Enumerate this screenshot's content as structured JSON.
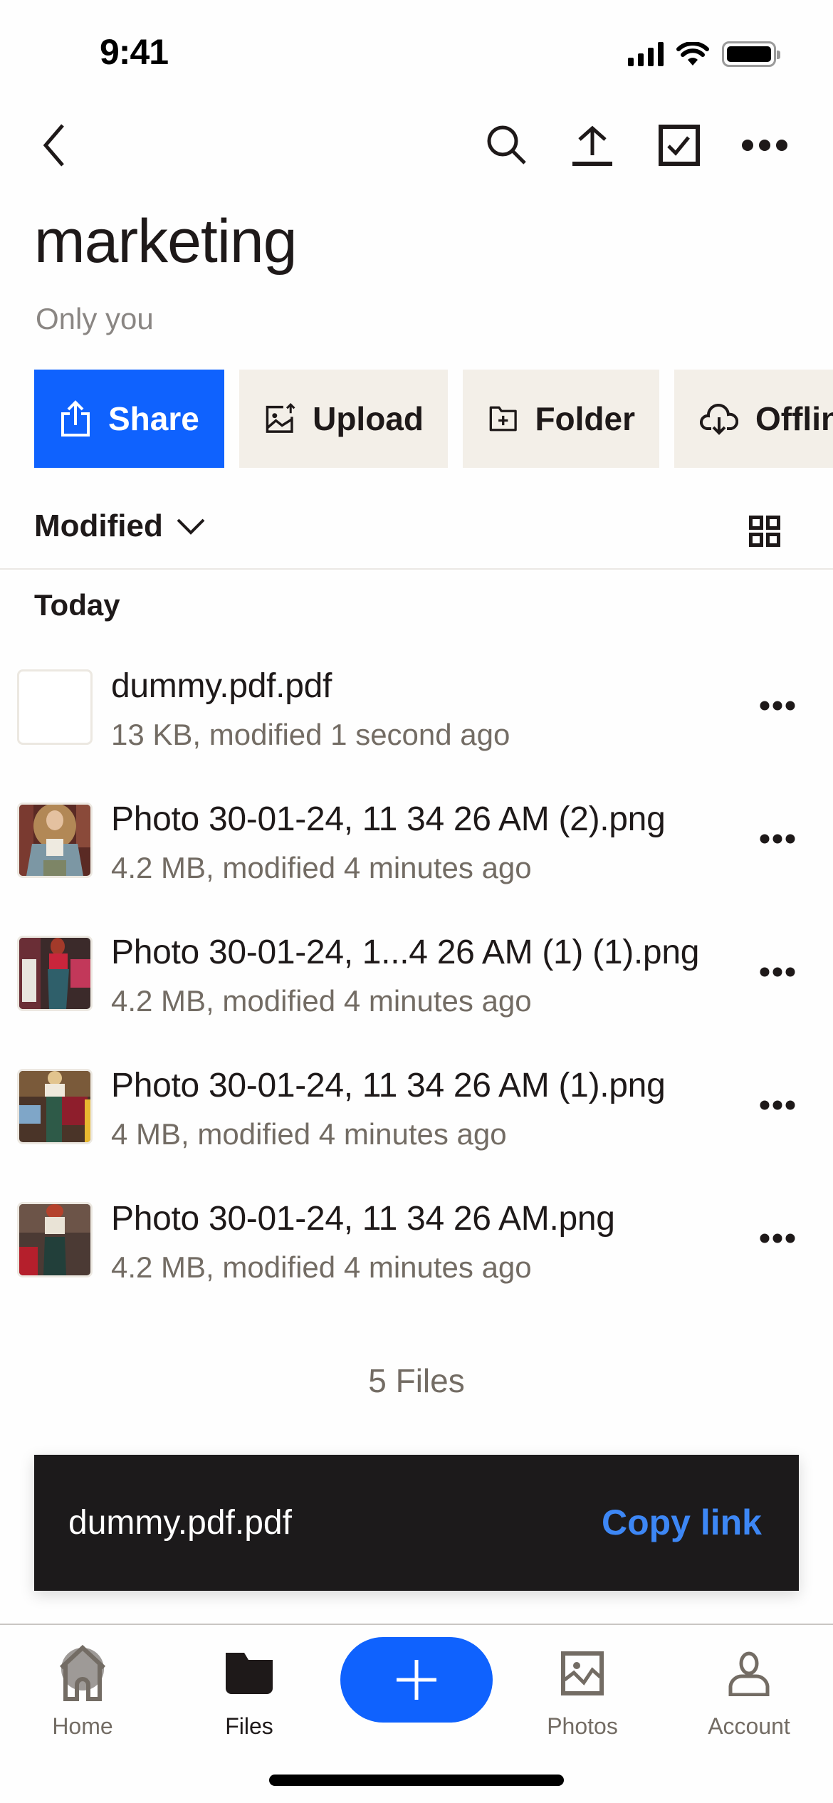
{
  "status_bar": {
    "time": "9:41"
  },
  "header": {
    "back_icon": "chevron-left-icon",
    "actions": [
      {
        "name": "search",
        "icon": "search-icon"
      },
      {
        "name": "upload",
        "icon": "upload-icon"
      },
      {
        "name": "select",
        "icon": "checkbox-icon"
      },
      {
        "name": "more",
        "icon": "more-horizontal-icon"
      }
    ]
  },
  "folder": {
    "title": "marketing",
    "sharing": "Only you"
  },
  "action_buttons": [
    {
      "label": "Share",
      "icon": "share-icon",
      "primary": true
    },
    {
      "label": "Upload",
      "icon": "image-upload-icon"
    },
    {
      "label": "Folder",
      "icon": "folder-plus-icon"
    },
    {
      "label": "Offline",
      "icon": "cloud-download-icon"
    }
  ],
  "sort": {
    "label": "Modified",
    "view_toggle_icon": "grid-view-icon"
  },
  "section": {
    "label": "Today"
  },
  "files": [
    {
      "name": "dummy.pdf.pdf",
      "meta": "13 KB, modified 1 second ago",
      "thumbnail": "blank"
    },
    {
      "name": "Photo 30-01-24, 11 34 26 AM (2).png",
      "meta": "4.2 MB, modified 4 minutes ago",
      "thumbnail": "photo"
    },
    {
      "name": "Photo 30-01-24, 1...4 26 AM (1) (1).png",
      "meta": "4.2 MB, modified 4 minutes ago",
      "thumbnail": "photo"
    },
    {
      "name": "Photo 30-01-24, 11 34 26 AM (1).png",
      "meta": "4 MB, modified 4 minutes ago",
      "thumbnail": "photo"
    },
    {
      "name": "Photo 30-01-24, 11 34 26 AM.png",
      "meta": "4.2 MB, modified 4 minutes ago",
      "thumbnail": "photo"
    }
  ],
  "file_count": "5 Files",
  "snackbar": {
    "text": "dummy.pdf.pdf",
    "action": "Copy link"
  },
  "tab_bar": {
    "tabs": [
      {
        "label": "Home",
        "icon": "home-icon",
        "active": false
      },
      {
        "label": "Files",
        "icon": "folder-icon",
        "active": true
      },
      {
        "label": "Photos",
        "icon": "photo-icon",
        "active": false
      },
      {
        "label": "Account",
        "icon": "account-icon",
        "active": false
      }
    ],
    "fab_icon": "plus-icon"
  },
  "colors": {
    "primary": "#0f62fe",
    "secondary_button_bg": "#f3efe8",
    "text": "#1e1919",
    "muted_text": "#736c64",
    "snackbar_bg": "#1c1a1b",
    "snackbar_action": "#3d87f5"
  }
}
